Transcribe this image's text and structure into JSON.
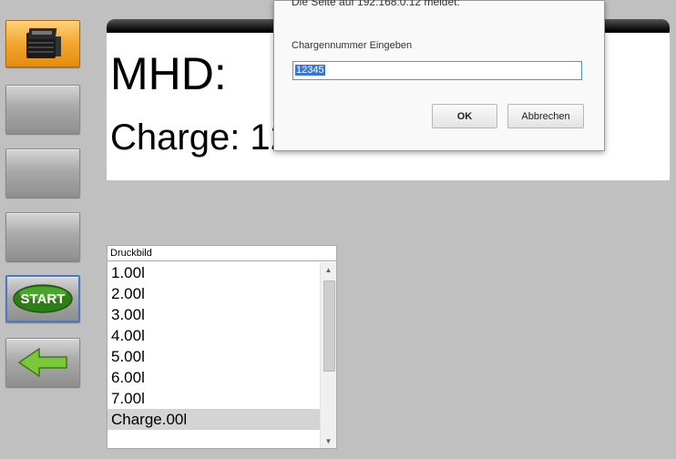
{
  "sidebar": {
    "items": [
      {
        "name": "printer",
        "label": ""
      },
      {
        "name": "blank-1",
        "label": ""
      },
      {
        "name": "blank-2",
        "label": ""
      },
      {
        "name": "blank-3",
        "label": ""
      },
      {
        "name": "start",
        "label": "START"
      },
      {
        "name": "back",
        "label": ""
      }
    ]
  },
  "info": {
    "mhd_label": "MHD:",
    "charge_label": "Charge: 12345"
  },
  "list": {
    "header": "Druckbild",
    "items": [
      "1.00l",
      "2.00l",
      "3.00l",
      "4.00l",
      "5.00l",
      "6.00l",
      "7.00l",
      "Charge.00l"
    ],
    "selected_index": 7
  },
  "dialog": {
    "title": "Die Seite auf 192.168.0.12 meldet:",
    "prompt": "Chargennummer Eingeben",
    "input_value": "12345",
    "ok_label": "OK",
    "cancel_label": "Abbrechen"
  },
  "colors": {
    "background": "#c0c0c0",
    "accent_orange": "#f3a630",
    "start_green": "#3c8f1e",
    "selection_blue": "#3875d7"
  }
}
